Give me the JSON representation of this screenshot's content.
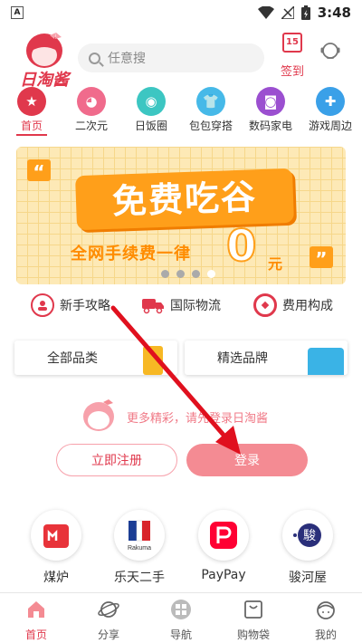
{
  "status_bar": {
    "time": "3:48",
    "badge": "A"
  },
  "header": {
    "logo_text": "日淘酱",
    "search_placeholder": "任意搜",
    "signin_label": "签到",
    "signin_day": "15"
  },
  "categories": [
    {
      "label": "首页",
      "color": "#e0384c",
      "active": true
    },
    {
      "label": "二次元",
      "color": "#f06b8c"
    },
    {
      "label": "日饭圈",
      "color": "#3cc6c2"
    },
    {
      "label": "包包穿搭",
      "color": "#46b9e8"
    },
    {
      "label": "数码家电",
      "color": "#9b4fd0"
    },
    {
      "label": "游戏周边",
      "color": "#3aa0e8"
    }
  ],
  "banner": {
    "headline": "免费吃谷",
    "subline": "全网手续费一律",
    "zero": "0",
    "unit": "元",
    "slide_count": 4,
    "active_slide": 4
  },
  "quick_links": [
    {
      "label": "新手攻略"
    },
    {
      "label": "国际物流"
    },
    {
      "label": "费用构成"
    }
  ],
  "category_boxes": [
    {
      "label": "全部品类"
    },
    {
      "label": "精选品牌"
    }
  ],
  "login": {
    "message": "更多精彩，请先登录日淘酱",
    "register_label": "立即注册",
    "login_label": "登录"
  },
  "partners": [
    {
      "label": "煤炉",
      "brand_color": "#e8333a",
      "logo_text": "m"
    },
    {
      "label": "乐天二手",
      "brand_color": "#bf0000",
      "logo_text": "Rakuma"
    },
    {
      "label": "PayPay",
      "brand_color": "#ff0033",
      "logo_text": "P"
    },
    {
      "label": "骏河屋",
      "brand_color": "#2a2f7a",
      "logo_text": "駿"
    }
  ],
  "tabs": [
    {
      "label": "首页",
      "active": true
    },
    {
      "label": "分享"
    },
    {
      "label": "导航"
    },
    {
      "label": "购物袋"
    },
    {
      "label": "我的"
    }
  ],
  "colors": {
    "accent": "#e0384c",
    "login_button": "#f48b93",
    "annotation_arrow": "#e0101e"
  }
}
